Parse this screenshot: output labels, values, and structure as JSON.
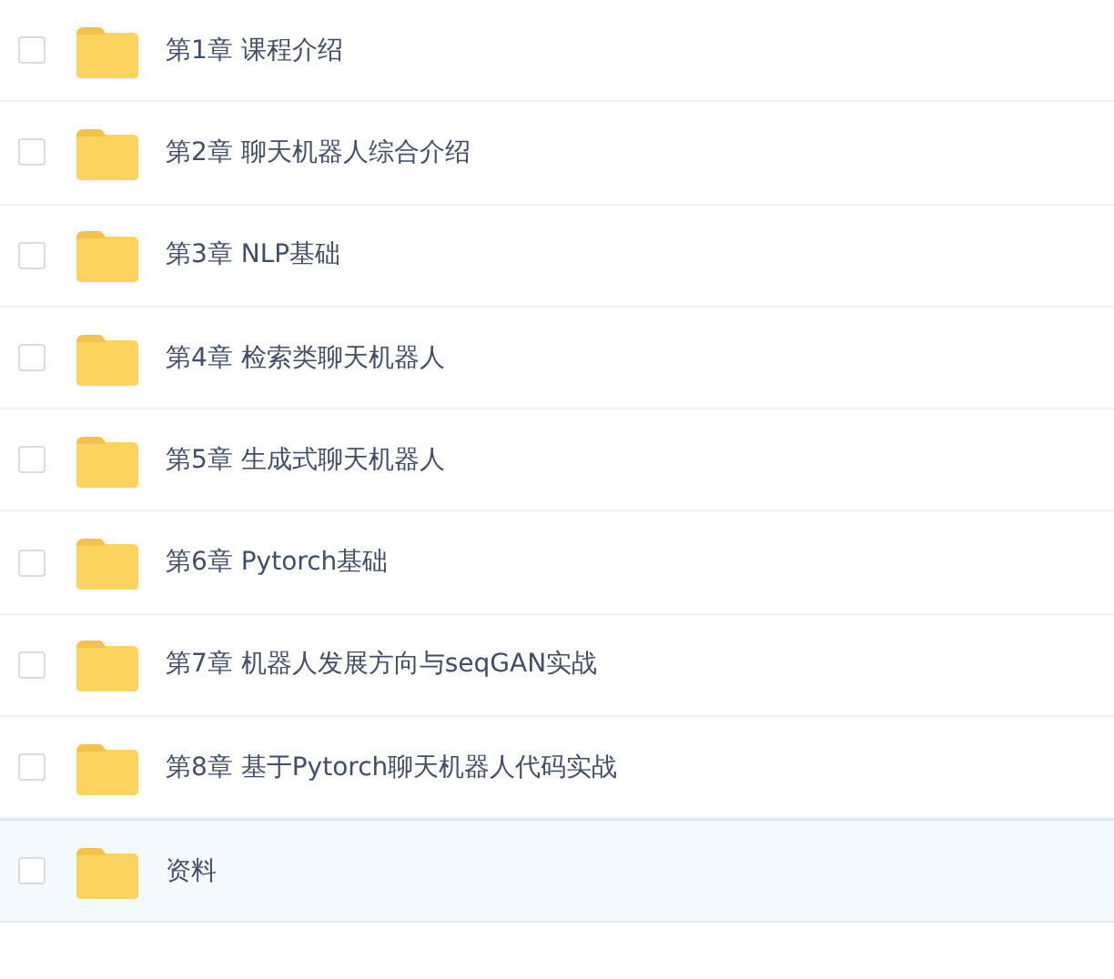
{
  "files": [
    {
      "name": "第1章 课程介绍",
      "checked": false,
      "selected": false
    },
    {
      "name": "第2章 聊天机器人综合介绍",
      "checked": false,
      "selected": false
    },
    {
      "name": "第3章 NLP基础",
      "checked": false,
      "selected": false
    },
    {
      "name": "第4章 检索类聊天机器人",
      "checked": false,
      "selected": false
    },
    {
      "name": "第5章 生成式聊天机器人",
      "checked": false,
      "selected": false
    },
    {
      "name": "第6章 Pytorch基础",
      "checked": false,
      "selected": false
    },
    {
      "name": "第7章 机器人发展方向与seqGAN实战",
      "checked": false,
      "selected": false
    },
    {
      "name": "第8章 基于Pytorch聊天机器人代码实战",
      "checked": false,
      "selected": false
    },
    {
      "name": "资料",
      "checked": false,
      "selected": true
    }
  ]
}
